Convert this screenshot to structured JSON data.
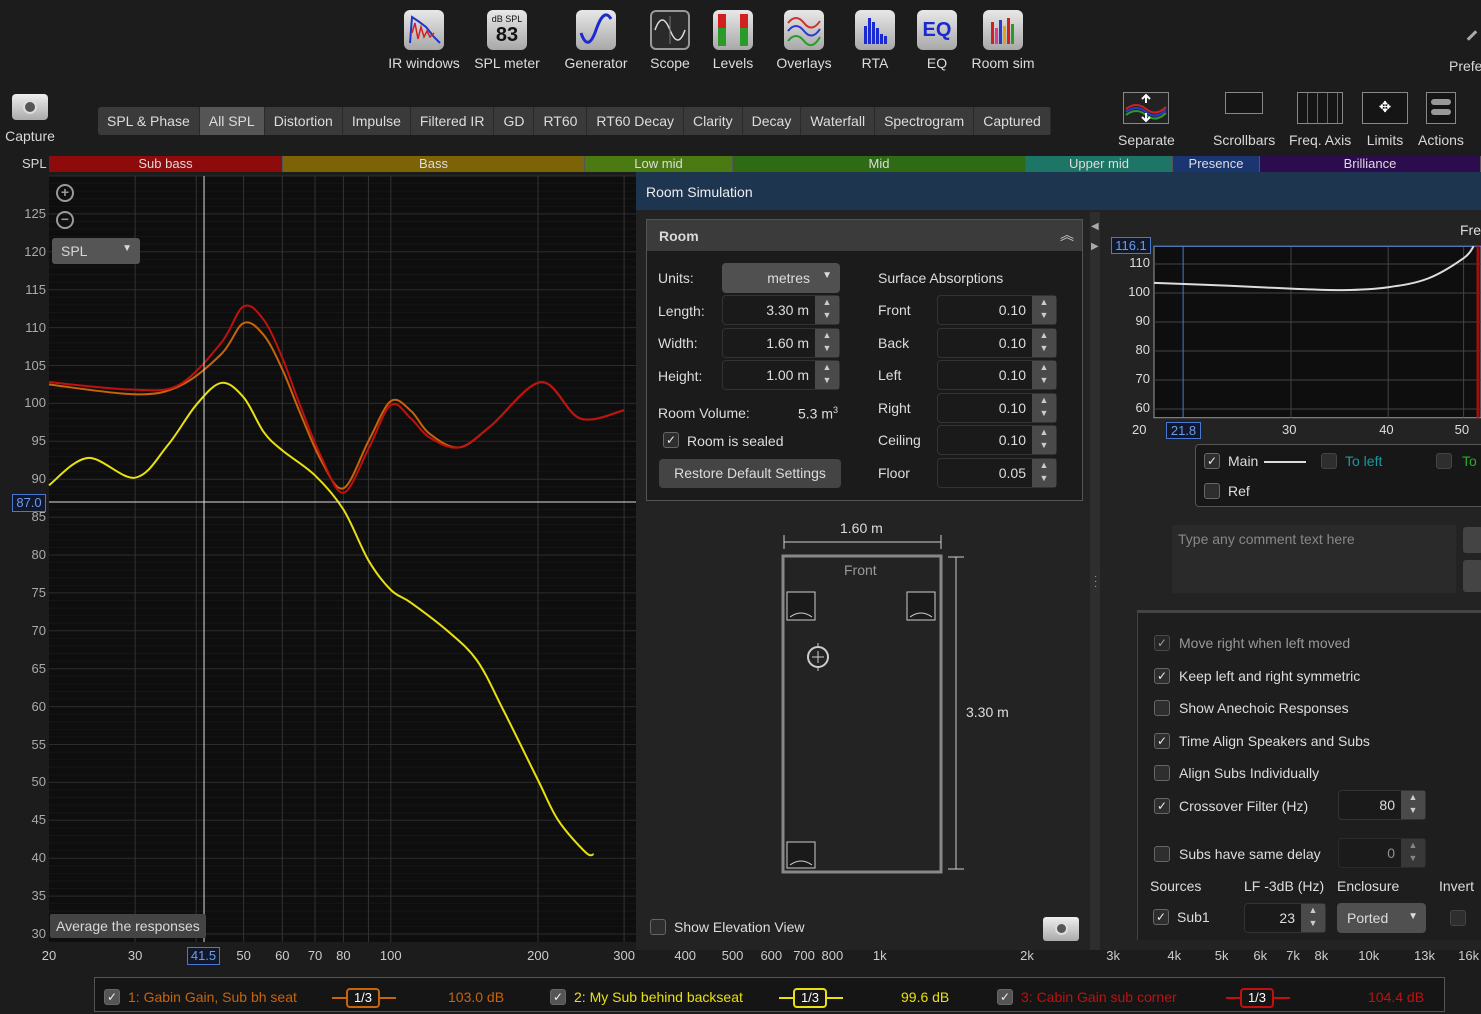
{
  "toolbar": {
    "items": [
      {
        "label": "IR windows",
        "icon": "ir-windows-icon"
      },
      {
        "label": "SPL meter",
        "icon": "spl-meter-icon",
        "meter_caption": "dB SPL",
        "meter_value": "83"
      },
      {
        "label": "Generator",
        "icon": "generator-icon"
      },
      {
        "label": "Scope",
        "icon": "scope-icon"
      },
      {
        "label": "Levels",
        "icon": "levels-icon"
      },
      {
        "label": "Overlays",
        "icon": "overlays-icon"
      },
      {
        "label": "RTA",
        "icon": "rta-icon"
      },
      {
        "label": "EQ",
        "icon": "eq-icon",
        "glyph": "EQ"
      },
      {
        "label": "Room sim",
        "icon": "room-sim-icon"
      }
    ],
    "preferences_label": "Prefe"
  },
  "capture_label": "Capture",
  "tabs": [
    "SPL & Phase",
    "All SPL",
    "Distortion",
    "Impulse",
    "Filtered IR",
    "GD",
    "RT60",
    "RT60 Decay",
    "Clarity",
    "Decay",
    "Waterfall",
    "Spectrogram",
    "Captured"
  ],
  "active_tab": "All SPL",
  "graph_tools": {
    "separate": "Separate",
    "scrollbars": "Scrollbars",
    "freq_axis": "Freq. Axis",
    "limits": "Limits",
    "actions": "Actions"
  },
  "bands": [
    {
      "label": "Sub bass",
      "color": "#8e0b0b"
    },
    {
      "label": "Bass",
      "color": "#7d6308"
    },
    {
      "label": "Low mid",
      "color": "#4b7a12"
    },
    {
      "label": "Mid",
      "color": "#2f6a14"
    },
    {
      "label": "Upper mid",
      "color": "#1c7565"
    },
    {
      "label": "Presence",
      "color": "#1a3670"
    },
    {
      "label": "Brilliance",
      "color": "#2c0b4e"
    }
  ],
  "graph": {
    "y_label": "SPL",
    "mode_select": "SPL",
    "average_button": "Average the responses",
    "cursor_freq": "41.5",
    "cursor_level": "87.0"
  },
  "chart_data": {
    "type": "line",
    "xscale": "log",
    "xlim": [
      20,
      300
    ],
    "ylim": [
      30,
      130
    ],
    "grid": true,
    "y_ticks": [
      "125",
      "120",
      "115",
      "110",
      "105",
      "100",
      "95",
      "90",
      "85",
      "80",
      "75",
      "70",
      "65",
      "60",
      "55",
      "50",
      "45",
      "40",
      "35",
      "30"
    ],
    "x_ticks": [
      "20",
      "30",
      "40",
      "50",
      "60",
      "70",
      "80",
      "100",
      "200",
      "300",
      "400",
      "500",
      "600",
      "700",
      "800",
      "1k",
      "2k",
      "3k",
      "4k",
      "5k",
      "6k",
      "7k",
      "8k",
      "10k",
      "13k",
      "16k"
    ],
    "cursor": {
      "x": 41.5,
      "y": 87.0
    },
    "series": [
      {
        "name": "1: Gabin Gain, Sub bh seat",
        "color": "#c8640a",
        "x": [
          20,
          30,
          37,
          45,
          50,
          55,
          60,
          65,
          72,
          80,
          90,
          100,
          110,
          120,
          138,
          160,
          203,
          244,
          300
        ],
        "y": [
          102.5,
          101.2,
          102.3,
          106.5,
          110.6,
          109,
          104.5,
          99,
          92.5,
          88.8,
          95,
          100.3,
          99,
          96,
          94.2,
          97,
          102.8,
          98,
          99.1
        ]
      },
      {
        "name": "2: My Sub behind backseat",
        "color": "#e8e010",
        "x": [
          20,
          24,
          30,
          35,
          40,
          45,
          50,
          55,
          60,
          70,
          80,
          90,
          100,
          110,
          130,
          150,
          170,
          200,
          220,
          250,
          260
        ],
        "y": [
          89.2,
          92.8,
          90.2,
          94.5,
          99.8,
          102.7,
          100.8,
          96.2,
          93.8,
          90.5,
          86,
          79.3,
          75.4,
          73.7,
          70.1,
          66.1,
          59.5,
          50.3,
          45,
          40.8,
          40.5
        ]
      },
      {
        "name": "3: Cabin Gain sub corner",
        "color": "#c01010",
        "x": [
          20,
          30,
          37,
          45,
          50,
          55,
          60,
          65,
          72,
          80,
          90,
          100,
          110,
          120,
          138,
          160,
          203,
          244,
          300
        ],
        "y": [
          102.8,
          101.8,
          102.5,
          108,
          112.8,
          111,
          106,
          100,
          93,
          88.2,
          94,
          99.8,
          98,
          95.5,
          94.2,
          97,
          102.8,
          98,
          99.1
        ]
      }
    ]
  },
  "legend": [
    {
      "label": "1: Gabin Gain, Sub bh seat",
      "smoothing": "1/3",
      "level": "103.0 dB",
      "color": "#c8640a",
      "checked": true
    },
    {
      "label": "2: My Sub behind backseat",
      "smoothing": "1/3",
      "level": "99.6 dB",
      "color": "#e8e010",
      "checked": true
    },
    {
      "label": "3: Cabin Gain sub corner",
      "smoothing": "1/3",
      "level": "104.4 dB",
      "color": "#c01010",
      "checked": true
    }
  ],
  "room_sim": {
    "title": "Room Simulation",
    "room_panel": {
      "title": "Room",
      "units_label": "Units:",
      "units_value": "metres",
      "length_label": "Length:",
      "length": "3.30 m",
      "width_label": "Width:",
      "width": "1.60 m",
      "height_label": "Height:",
      "height": "1.00 m",
      "volume_label": "Room Volume:",
      "volume": "5.3 m",
      "volume_sup": "3",
      "sealed_label": "Room is sealed",
      "sealed": true,
      "restore_button": "Restore Default Settings",
      "absorptions_title": "Surface Absorptions",
      "absorptions": [
        {
          "label": "Front",
          "value": "0.10"
        },
        {
          "label": "Back",
          "value": "0.10"
        },
        {
          "label": "Left",
          "value": "0.10"
        },
        {
          "label": "Right",
          "value": "0.10"
        },
        {
          "label": "Ceiling",
          "value": "0.10"
        },
        {
          "label": "Floor",
          "value": "0.05"
        }
      ]
    },
    "diagram": {
      "width_dim": "1.60 m",
      "length_dim": "3.30 m",
      "front_label": "Front"
    },
    "elevation_label": "Show Elevation View",
    "elevation": false,
    "mini_chart": {
      "title_partial": "Fre",
      "y_ticks": [
        "110",
        "100",
        "90",
        "80",
        "70",
        "60"
      ],
      "x_ticks": [
        "20",
        "30",
        "40",
        "50"
      ],
      "cursor_x": "21.8",
      "cursor_y": "116.1",
      "x": [
        20,
        25,
        30,
        35,
        40,
        45,
        50,
        51.5
      ],
      "y": [
        103.5,
        102.5,
        101.5,
        101,
        102,
        105,
        112,
        116.1
      ]
    },
    "mini_legend": {
      "main": "Main",
      "main_checked": true,
      "to_left": "To left",
      "to_right": "To",
      "ref": "Ref"
    },
    "comment_placeholder": "Type any comment text here",
    "options": [
      {
        "label": "Move right when left moved",
        "checked": true,
        "disabled": true
      },
      {
        "label": "Keep left and right symmetric",
        "checked": true
      },
      {
        "label": "Show Anechoic Responses",
        "checked": false
      },
      {
        "label": "Time Align Speakers and Subs",
        "checked": true
      },
      {
        "label": "Align Subs Individually",
        "checked": false
      },
      {
        "label": "Crossover Filter (Hz)",
        "checked": true,
        "value": "80"
      },
      {
        "label": "Subs have same delay",
        "checked": false,
        "value": "0"
      }
    ],
    "sources": {
      "headers": [
        "Sources",
        "LF -3dB (Hz)",
        "Enclosure",
        "Invert"
      ],
      "rows": [
        {
          "name": "Sub1",
          "checked": true,
          "lf": "23",
          "enclosure": "Ported",
          "invert": false
        }
      ]
    }
  }
}
